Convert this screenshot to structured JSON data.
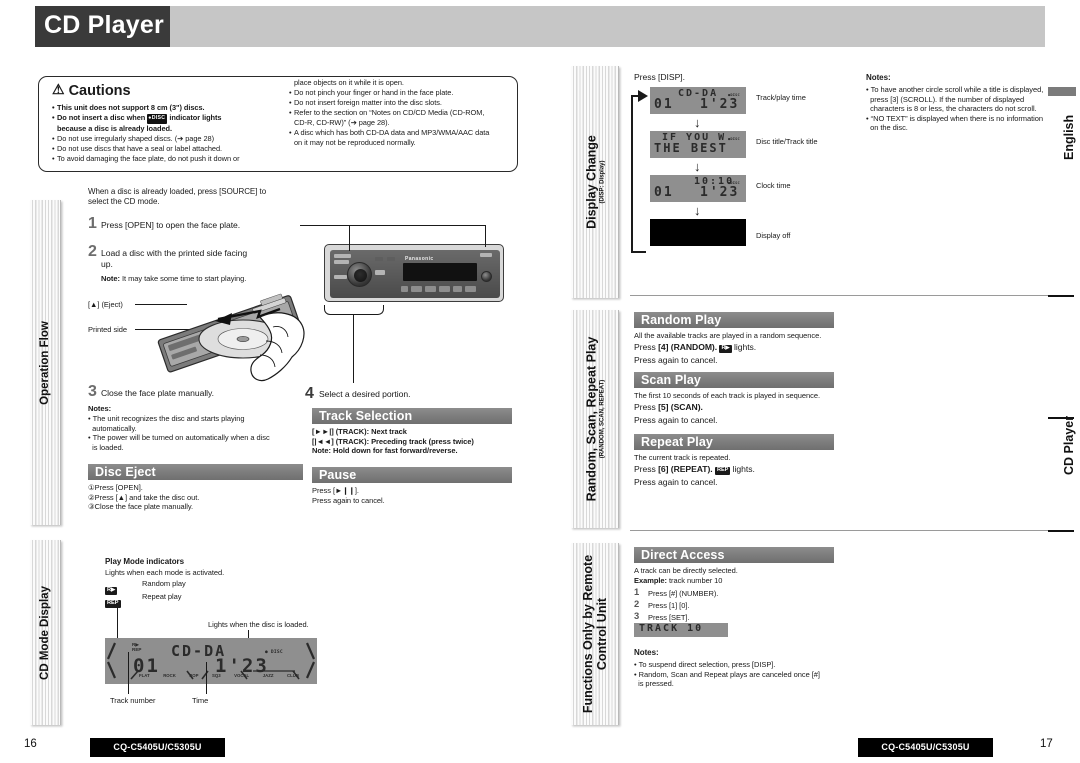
{
  "header": {
    "title": "CD Player"
  },
  "cautions": {
    "heading": "Cautions",
    "warning_icon": "warning-triangle-icon",
    "left_items": [
      {
        "text": "This unit does not support 8 cm (3\") discs.",
        "bold": true
      },
      {
        "text": "Do not insert a disc when ●DISC indicator lights",
        "bold": true
      },
      {
        "text": "because a disc is already loaded.",
        "bold": true,
        "indent": true
      },
      {
        "text": "Do not use irregularly shaped discs. (➔ page 28)",
        "bold": false
      },
      {
        "text": "Do not use discs that have a seal or label attached.",
        "bold": false
      },
      {
        "text": "To avoid damaging the face plate, do not push it down or",
        "bold": false
      }
    ],
    "right_items": [
      {
        "text": "place objects on it while it is open.",
        "bullet": false,
        "indent": true
      },
      {
        "text": "Do not pinch your finger or hand in the face plate.",
        "bullet": true
      },
      {
        "text": "Do not insert foreign matter into the disc slots.",
        "bullet": true
      },
      {
        "text": "Refer to the section on “Notes on CD/CD Media (CD-ROM,",
        "bullet": true
      },
      {
        "text": "CD-R, CD-RW)” (➔ page 28).",
        "bullet": false,
        "indent": true
      },
      {
        "text": "A disc which has both CD-DA data and MP3/WMA/AAC data",
        "bullet": true
      },
      {
        "text": "on it may not be reproduced normally.",
        "bullet": false,
        "indent": true
      }
    ]
  },
  "side_tabs": {
    "operation_flow": {
      "label": "Operation Flow",
      "sub": ""
    },
    "cd_mode_display": {
      "label": "CD Mode Display",
      "sub": ""
    },
    "display_change": {
      "label": "Display Change",
      "sub": "(DISP: Display)"
    },
    "random_scan_repeat": {
      "label": "Random, Scan, Repeat Play",
      "sub": "(RANDOM, SCAN, REPEAT)"
    },
    "remote_only": {
      "label_line1": "Functions Only by Remote",
      "label_line2": "Control Unit"
    }
  },
  "operation_flow": {
    "intro_line1": "When a disc is already loaded, press [SOURCE] to",
    "intro_line2": "select the CD mode.",
    "step1": {
      "num": "1",
      "text": "Press [OPEN] to open the face plate."
    },
    "step2": {
      "num": "2",
      "line1": "Load a disc with the printed side facing",
      "line2": "up.",
      "note_label": "Note:",
      "note_text": "It may take some time to start playing."
    },
    "callout_eject": "[▲] (Eject)",
    "callout_printed": "Printed side",
    "step3": {
      "num": "3",
      "text": "Close the face plate manually.",
      "notes_label": "Notes:",
      "notes": [
        "The unit recognizes the disc and starts playing",
        "automatically.",
        "The power will be turned on automatically when a disc",
        "is loaded."
      ]
    },
    "step4": {
      "num": "4",
      "text": "Select a desired portion."
    },
    "unit_brand": "Panasonic"
  },
  "disc_eject": {
    "title": "Disc Eject",
    "items": [
      "①Press [OPEN].",
      "②Press [▲] and take the disc out.",
      "③Close the face plate manually."
    ]
  },
  "track_selection": {
    "title": "Track Selection",
    "lines": [
      "[►►|] (TRACK): Next track",
      "[|◄◄] (TRACK): Preceding track (press twice)",
      "Note: Hold down for fast forward/reverse."
    ]
  },
  "pause": {
    "title": "Pause",
    "lines": [
      "Press [►❙❙].",
      "Press again to cancel."
    ]
  },
  "cd_mode_display": {
    "play_mode_title": "Play Mode indicators",
    "play_mode_sub": "Lights when each mode is activated.",
    "random_chip": "R▶",
    "random_label": "Random play",
    "repeat_chip": "REP",
    "repeat_label": "Repeat play",
    "disc_loaded_note": "Lights when the disc is loaded.",
    "lcd": {
      "top_text": "CD-DA",
      "track": "01",
      "time": "1'23",
      "disc_indicator": "● DISC",
      "eq_labels": [
        "FLAT",
        "ROCK",
        "POP",
        "SQ3",
        "VOCAL",
        "JAZZ",
        "CLUB"
      ]
    },
    "callout_track": "Track number",
    "callout_time": "Time"
  },
  "display_change": {
    "press_line": "Press [DISP].",
    "steps": [
      {
        "lcd_top": "CD-DA",
        "lcd_track": "01",
        "lcd_time": "1'23",
        "disc": true,
        "label": "Track/play time",
        "off": false
      },
      {
        "lcd_top": "IF YOU W",
        "lcd_track": "THE BEST",
        "lcd_time": "",
        "disc": true,
        "label": "Disc title/Track title",
        "off": false
      },
      {
        "lcd_top": "10:10",
        "lcd_track": "01",
        "lcd_time": "1'23",
        "disc": true,
        "label": "Clock time",
        "off": false
      },
      {
        "lcd_top": "",
        "lcd_track": "",
        "lcd_time": "",
        "disc": false,
        "label": "Display off",
        "off": true
      }
    ],
    "notes_label": "Notes:",
    "notes": [
      "To have another circle scroll while a title is displayed,",
      "press [3] (SCROLL). If the number of displayed",
      "characters is 8 or less, the characters do not scroll.",
      "“NO TEXT” is displayed when there is no information",
      "on the disc."
    ]
  },
  "random_play": {
    "title": "Random Play",
    "desc": "All the available tracks are played in a random sequence.",
    "press_pre": "Press ",
    "press_key": "[4] (RANDOM).",
    "chip": "R▶",
    "press_post": " lights.",
    "cancel": "Press again to cancel."
  },
  "scan_play": {
    "title": "Scan Play",
    "desc": "The first 10 seconds of each track is played in sequence.",
    "press_pre": "Press ",
    "press_key": "[5] (SCAN).",
    "cancel": "Press again to cancel."
  },
  "repeat_play": {
    "title": "Repeat Play",
    "desc": "The current track is repeated.",
    "press_pre": "Press ",
    "press_key": "[6] (REPEAT).",
    "chip": "REP",
    "press_post": " lights.",
    "cancel": "Press again to cancel."
  },
  "direct_access": {
    "title": "Direct Access",
    "desc": "A track can be directly selected.",
    "example_label": "Example:",
    "example_text": " track number 10",
    "steps": [
      {
        "num": "1",
        "text": "Press [#] (NUMBER)."
      },
      {
        "num": "2",
        "text": "Press [1] [0]."
      },
      {
        "num": "3",
        "text": "Press [SET]."
      }
    ],
    "lcd_text": "TRACK 10",
    "notes_label": "Notes:",
    "notes": [
      "To suspend direct selection, press [DISP].",
      "Random, Scan and Repeat plays are canceled once [#]",
      "is pressed."
    ]
  },
  "edge_tabs": {
    "english": "English",
    "cd_player": "CD Player"
  },
  "footer": {
    "left_page": "16",
    "left_model": "CQ-C5405U/C5305U",
    "right_model": "CQ-C5405U/C5305U",
    "right_page": "17"
  },
  "colors": {
    "header_dark": "#3a3a3a",
    "header_light": "#c6c6c6",
    "section_gray": "#7c7c7c",
    "lcd_gray": "#8f8f8f",
    "ink": "#1a1a1a"
  }
}
